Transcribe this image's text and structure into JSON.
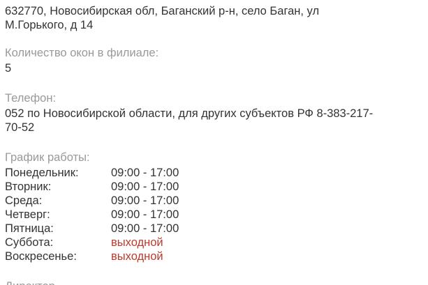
{
  "address": {
    "line1": "632770, Новосибирская обл, Баганский р-н, село Баган, ул",
    "line2": "М.Горького, д 14"
  },
  "windows": {
    "label": "Количество окон в филиале:",
    "value": "5"
  },
  "phone": {
    "label": "Телефон:",
    "line1": "052 по Новосибирской области, для других субъектов РФ 8-383-217-",
    "line2": "70-52"
  },
  "schedule": {
    "label": "График работы:",
    "days": [
      {
        "day": "Понедельник:",
        "hours": "09:00 - 17:00"
      },
      {
        "day": "Вторник:",
        "hours": "09:00 - 17:00"
      },
      {
        "day": "Среда:",
        "hours": "09:00 - 17:00"
      },
      {
        "day": "Четверг:",
        "hours": "09:00 - 17:00"
      },
      {
        "day": "Пятница:",
        "hours": "09:00 - 17:00"
      },
      {
        "day": "Суббота:",
        "hours": "выходной"
      },
      {
        "day": "Воскресенье:",
        "hours": "выходной"
      }
    ],
    "off_color": "#c0392b"
  },
  "director": {
    "label": "Директор"
  },
  "colors": {
    "label": "#999999",
    "text": "#333333"
  }
}
